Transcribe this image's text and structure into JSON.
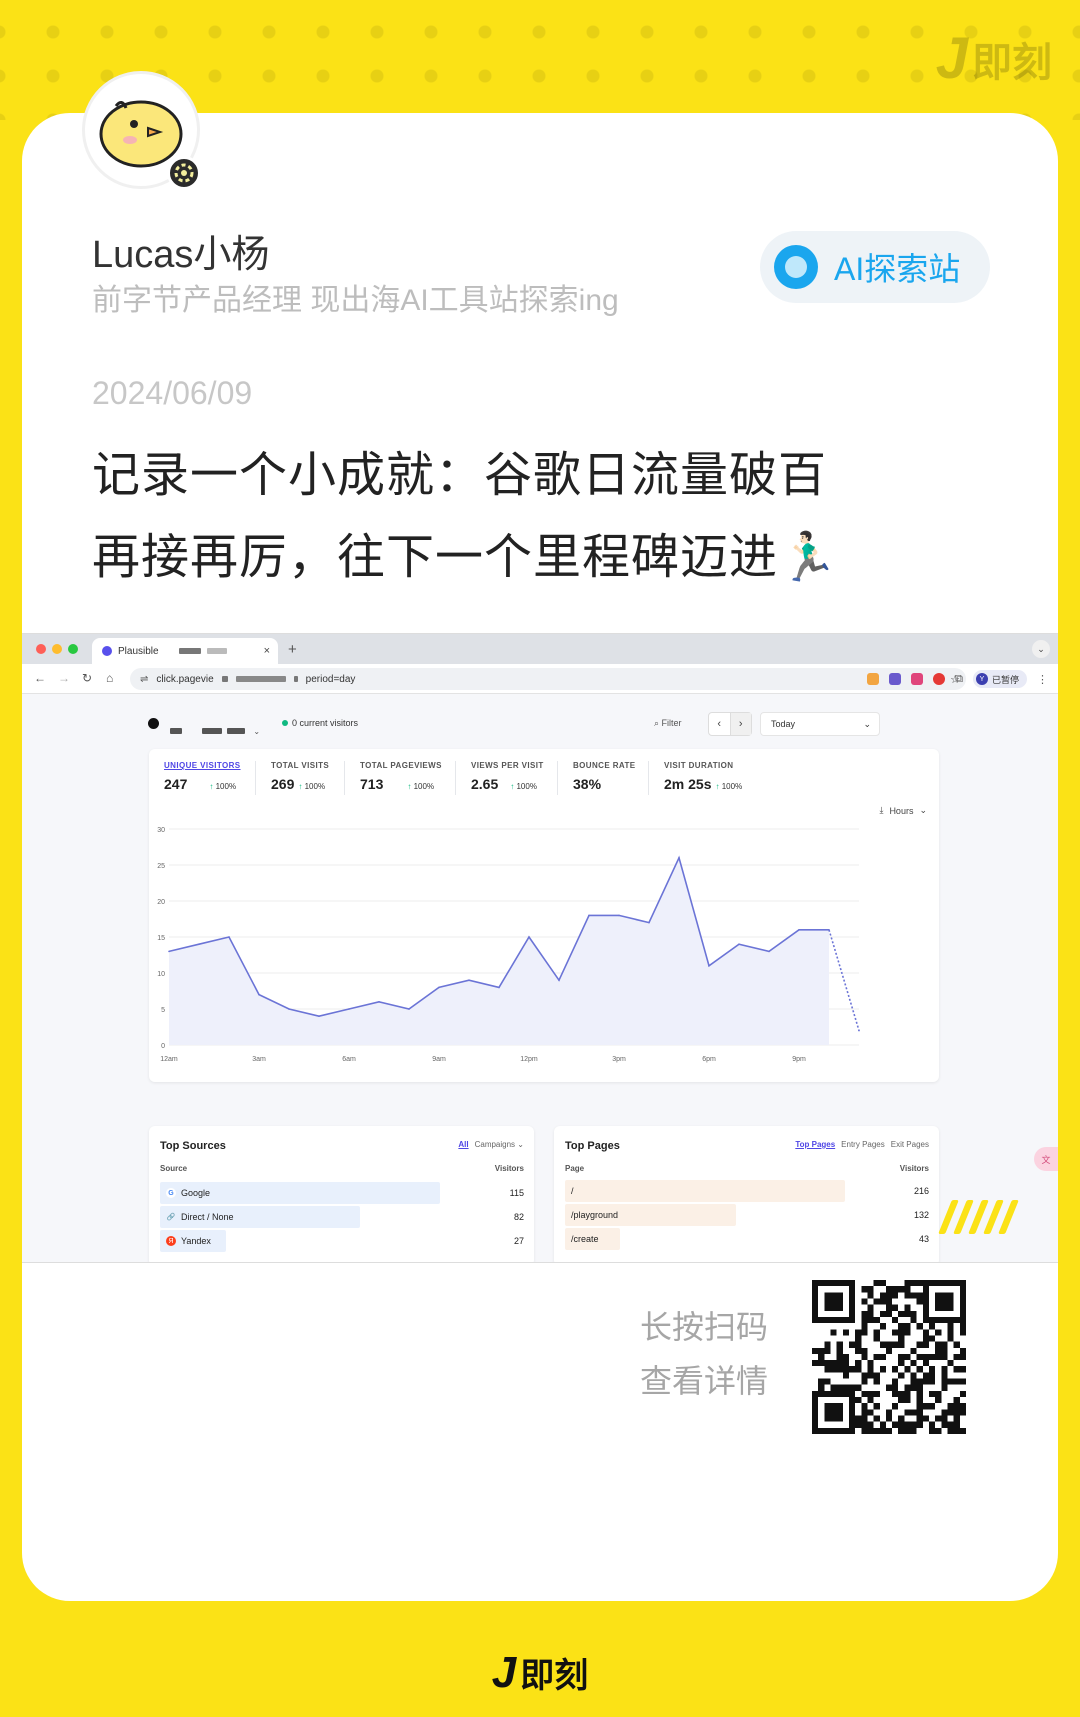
{
  "brand": {
    "logo_letter": "J",
    "name": "即刻"
  },
  "author": {
    "name": "Lucas小杨",
    "bio": "前字节产品经理 现出海AI工具站探索ing"
  },
  "topic": {
    "label": "AI探索站",
    "color": "#1aa6ee"
  },
  "post": {
    "date": "2024/06/09",
    "line1": "记录一个小成就：谷歌日流量破百",
    "line2": "再接再厉，往下一个里程碑迈进🏃🏻‍♂️"
  },
  "screenshot": {
    "tab_title": "Plausible",
    "tab_close": "×",
    "tab_add": "+",
    "url_prefix": "click.pagevie",
    "url_suffix": "period=day",
    "paused_label": "已暂停",
    "paused_avatar": "Y",
    "current_visitors": "0 current visitors",
    "filter_label": "Filter",
    "period": "Today",
    "interval": "Hours",
    "metrics": [
      {
        "label": "UNIQUE VISITORS",
        "value": "247",
        "change": "100%"
      },
      {
        "label": "TOTAL VISITS",
        "value": "269",
        "change": "100%"
      },
      {
        "label": "TOTAL PAGEVIEWS",
        "value": "713",
        "change": "100%"
      },
      {
        "label": "VIEWS PER VISIT",
        "value": "2.65",
        "change": "100%"
      },
      {
        "label": "BOUNCE RATE",
        "value": "38%",
        "change": ""
      },
      {
        "label": "VISIT DURATION",
        "value": "2m 25s",
        "change": "100%"
      }
    ],
    "sources": {
      "title": "Top Sources",
      "tab_all": "All",
      "tab_campaigns": "Campaigns",
      "col_source": "Source",
      "col_visitors": "Visitors",
      "rows": [
        {
          "name": "Google",
          "visitors": "115",
          "fraction": 1.0
        },
        {
          "name": "Direct / None",
          "visitors": "82",
          "fraction": 0.71
        },
        {
          "name": "Yandex",
          "visitors": "27",
          "fraction": 0.23
        }
      ]
    },
    "pages": {
      "title": "Top Pages",
      "tab_top": "Top Pages",
      "tab_entry": "Entry Pages",
      "tab_exit": "Exit Pages",
      "col_page": "Page",
      "col_visitors": "Visitors",
      "rows": [
        {
          "name": "/",
          "visitors": "216",
          "fraction": 1.0
        },
        {
          "name": "/playground",
          "visitors": "132",
          "fraction": 0.61
        },
        {
          "name": "/create",
          "visitors": "43",
          "fraction": 0.2
        }
      ]
    }
  },
  "chart_data": {
    "type": "line",
    "title": "",
    "xlabel": "",
    "ylabel": "",
    "ylim": [
      0,
      30
    ],
    "yticks": [
      0,
      5,
      10,
      15,
      20,
      25,
      30
    ],
    "xtick_labels": [
      "12am",
      "3am",
      "6am",
      "9am",
      "12pm",
      "3pm",
      "6pm",
      "9pm"
    ],
    "x": [
      "12am",
      "1am",
      "2am",
      "3am",
      "4am",
      "5am",
      "6am",
      "7am",
      "8am",
      "9am",
      "10am",
      "11am",
      "12pm",
      "1pm",
      "2pm",
      "3pm",
      "4pm",
      "5pm",
      "6pm",
      "7pm",
      "8pm",
      "9pm",
      "10pm",
      "11pm"
    ],
    "series": [
      {
        "values": [
          13,
          14,
          15,
          7,
          5,
          4,
          5,
          6,
          5,
          8,
          9,
          8,
          15,
          9,
          18,
          18,
          17,
          26,
          11,
          14,
          13,
          16,
          16,
          2
        ],
        "color": "#6b74d6"
      }
    ],
    "grid": true
  },
  "qr_hint": {
    "line1": "长按扫码",
    "line2": "查看详情"
  }
}
